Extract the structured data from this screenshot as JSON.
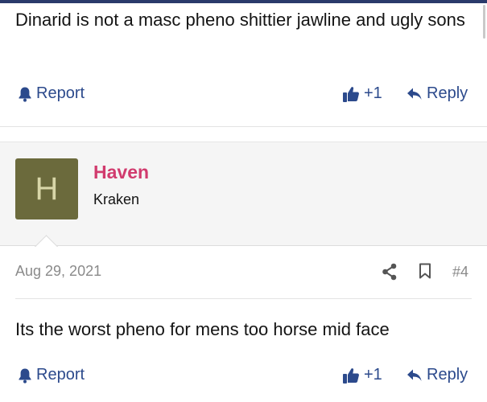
{
  "first_post": {
    "text": "Dinarid is not a masc pheno shittier jawline and ugly sons",
    "report_label": "Report",
    "like_count": "+1",
    "reply_label": "Reply"
  },
  "second_post": {
    "author": {
      "avatar_letter": "H",
      "avatar_color": "#6b6a3c",
      "name": "Haven",
      "title": "Kraken"
    },
    "date": "Aug 29, 2021",
    "post_number": "#4",
    "text": "Its the worst pheno for mens too horse mid face",
    "report_label": "Report",
    "like_count": "+1",
    "reply_label": "Reply"
  },
  "icons": {
    "report": "bell-icon",
    "like": "thumbs-up-icon",
    "reply": "reply-arrow-icon",
    "share": "share-icon",
    "bookmark": "bookmark-icon"
  },
  "colors": {
    "accent": "#2c4a8c",
    "username": "#d13b6e",
    "meta": "#8a8a8a"
  }
}
